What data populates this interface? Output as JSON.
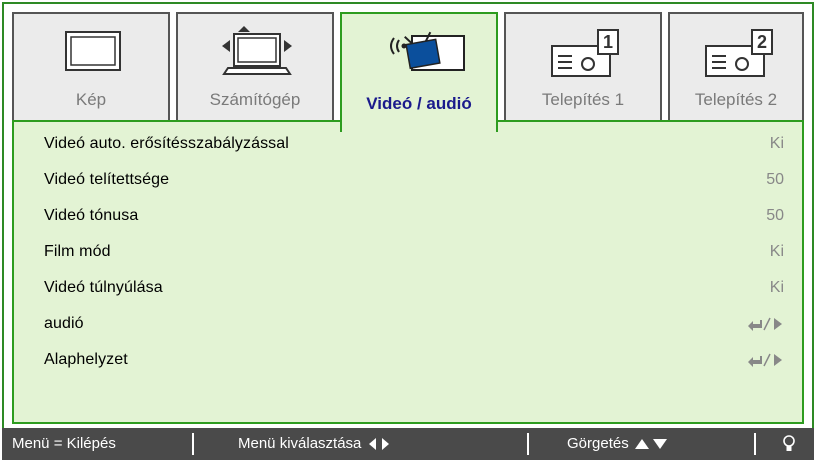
{
  "tabs": [
    {
      "label": "Kép",
      "icon": "monitor-icon"
    },
    {
      "label": "Számítógép",
      "icon": "computer-icon"
    },
    {
      "label": "Videó / audió",
      "icon": "video-audio-icon",
      "active": true
    },
    {
      "label": "Telepítés 1",
      "icon": "projector-setup-1-icon"
    },
    {
      "label": "Telepítés 2",
      "icon": "projector-setup-2-icon"
    }
  ],
  "menu": [
    {
      "label": "Videó auto. erősítésszabályzással",
      "value": "Ki"
    },
    {
      "label": "Videó telítettsége",
      "value": "50"
    },
    {
      "label": "Videó tónusa",
      "value": "50"
    },
    {
      "label": "Film mód",
      "value": "Ki"
    },
    {
      "label": "Videó túlnyúlása",
      "value": "Ki"
    },
    {
      "label": "audió",
      "value_icon": "enter-arrow-icon"
    },
    {
      "label": "Alaphelyzet",
      "value_icon": "enter-arrow-icon"
    }
  ],
  "footer": {
    "exit": "Menü = Kilépés",
    "select": "Menü kiválasztása",
    "scroll": "Görgetés",
    "lamp_icon": "bulb-icon"
  },
  "colors": {
    "accent_green": "#2e9c1f",
    "panel_bg": "#e3f3d4",
    "active_label": "#1a1a8c",
    "footer_bg": "#4a4a4a"
  }
}
